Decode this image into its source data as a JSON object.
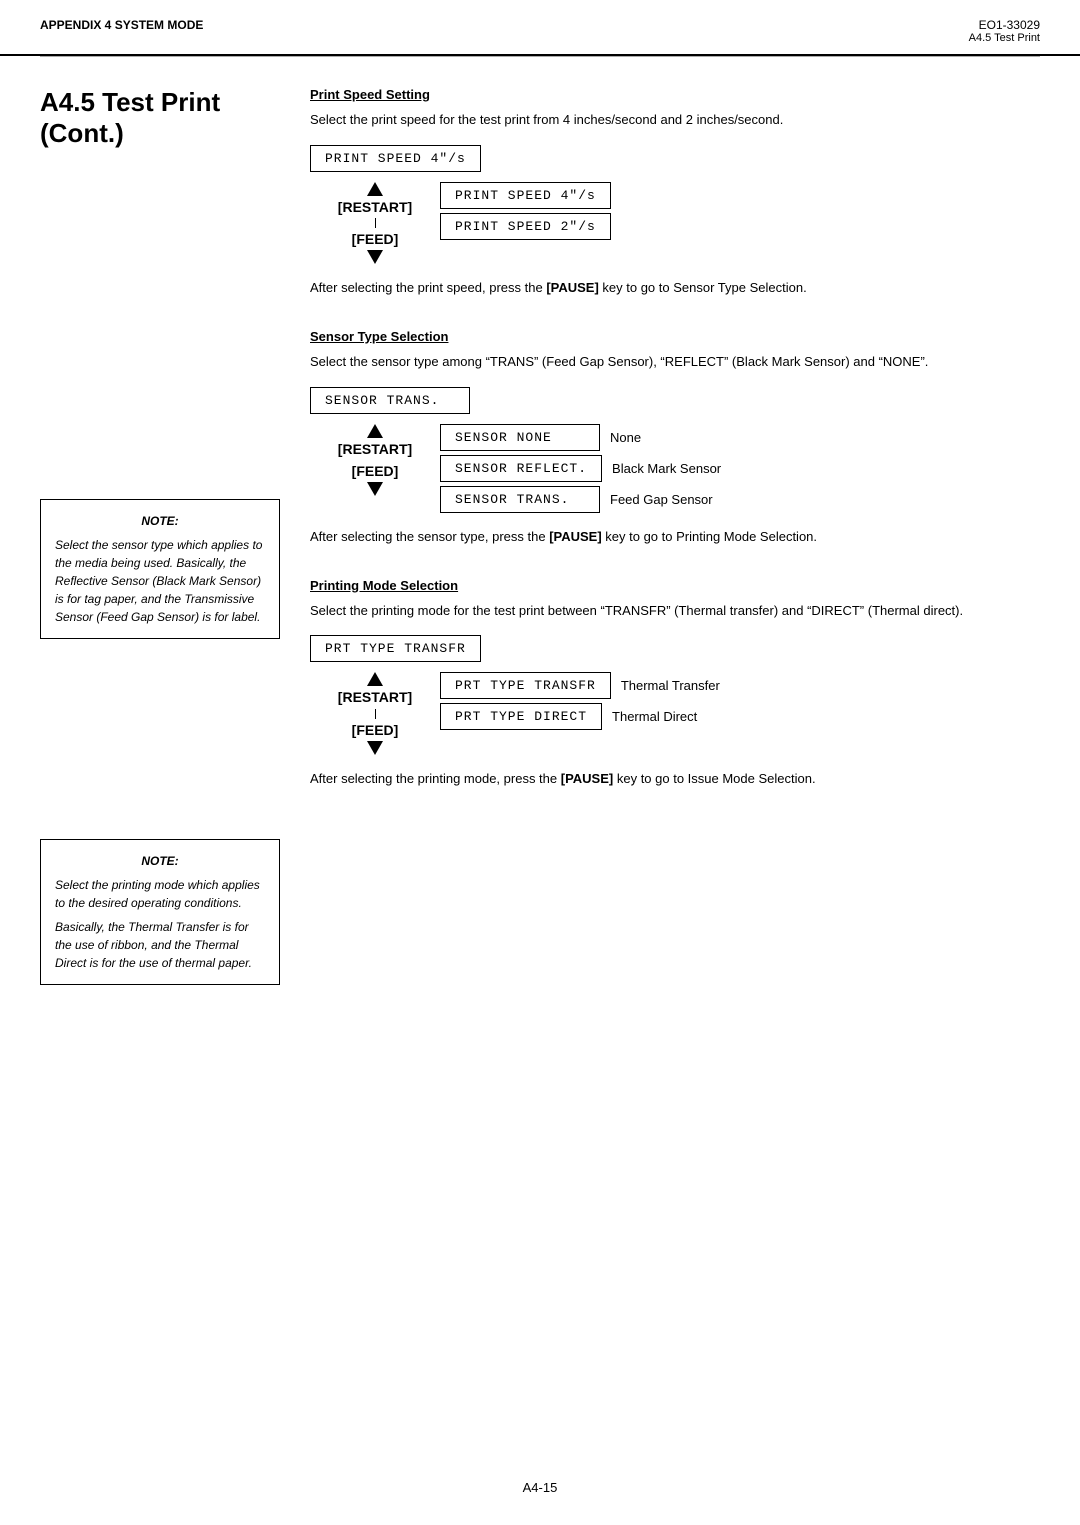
{
  "header": {
    "left": "APPENDIX 4 SYSTEM MODE",
    "doc_number": "EO1-33029",
    "section_ref": "A4.5 Test Print"
  },
  "section_title": "A4.5 Test Print (Cont.)",
  "print_speed": {
    "title": "Print Speed Setting",
    "description": "Select the print speed for the test print from 4 inches/second and 2 inches/second.",
    "current_display": "PRINT SPEED 4\"/s",
    "flow": {
      "restart_label": "[RESTART]",
      "feed_label": "[FEED]",
      "options": [
        {
          "display": "PRINT SPEED 4\"/s",
          "label": ""
        },
        {
          "display": "PRINT SPEED 2\"/s",
          "label": ""
        }
      ]
    },
    "after_text": "After selecting the print speed, press the [PAUSE] key to go to Sensor Type Selection."
  },
  "sensor_type": {
    "title": "Sensor Type Selection",
    "description": "Select the sensor type among “TRANS” (Feed Gap Sensor), “REFLECT” (Black Mark Sensor) and “NONE”.",
    "current_display": "SENSOR TRANS.",
    "flow": {
      "restart_label": "[RESTART]",
      "feed_label": "[FEED]",
      "options": [
        {
          "display": "SENSOR NONE",
          "label": "None"
        },
        {
          "display": "SENSOR REFLECT.",
          "label": "Black Mark Sensor"
        },
        {
          "display": "SENSOR TRANS.",
          "label": "Feed Gap Sensor"
        }
      ]
    },
    "after_text": "After selecting the sensor type, press the [PAUSE] key to go to Printing Mode Selection.",
    "note": {
      "title": "NOTE:",
      "text": "Select the sensor type which applies to the media being used. Basically, the Reflective Sensor (Black Mark Sensor) is for tag paper, and the Transmissive Sensor (Feed Gap Sensor) is for label."
    }
  },
  "printing_mode": {
    "title": "Printing Mode Selection",
    "description": "Select the printing mode for the test print between “TRANSFR” (Thermal transfer) and “DIRECT” (Thermal direct).",
    "current_display": "PRT TYPE TRANSFR",
    "flow": {
      "restart_label": "[RESTART]",
      "feed_label": "[FEED]",
      "options": [
        {
          "display": "PRT TYPE TRANSFR",
          "label": "Thermal Transfer"
        },
        {
          "display": "PRT TYPE DIRECT",
          "label": "Thermal Direct"
        }
      ]
    },
    "after_text": "After selecting the printing mode, press the [PAUSE] key to go to Issue Mode Selection.",
    "note": {
      "title": "NOTE:",
      "text1": "Select the printing mode which applies to the desired operating conditions.",
      "text2": "Basically, the Thermal Transfer is for the use of ribbon, and the Thermal Direct is for the use of thermal paper."
    }
  },
  "footer": {
    "page_label": "A4-15"
  }
}
